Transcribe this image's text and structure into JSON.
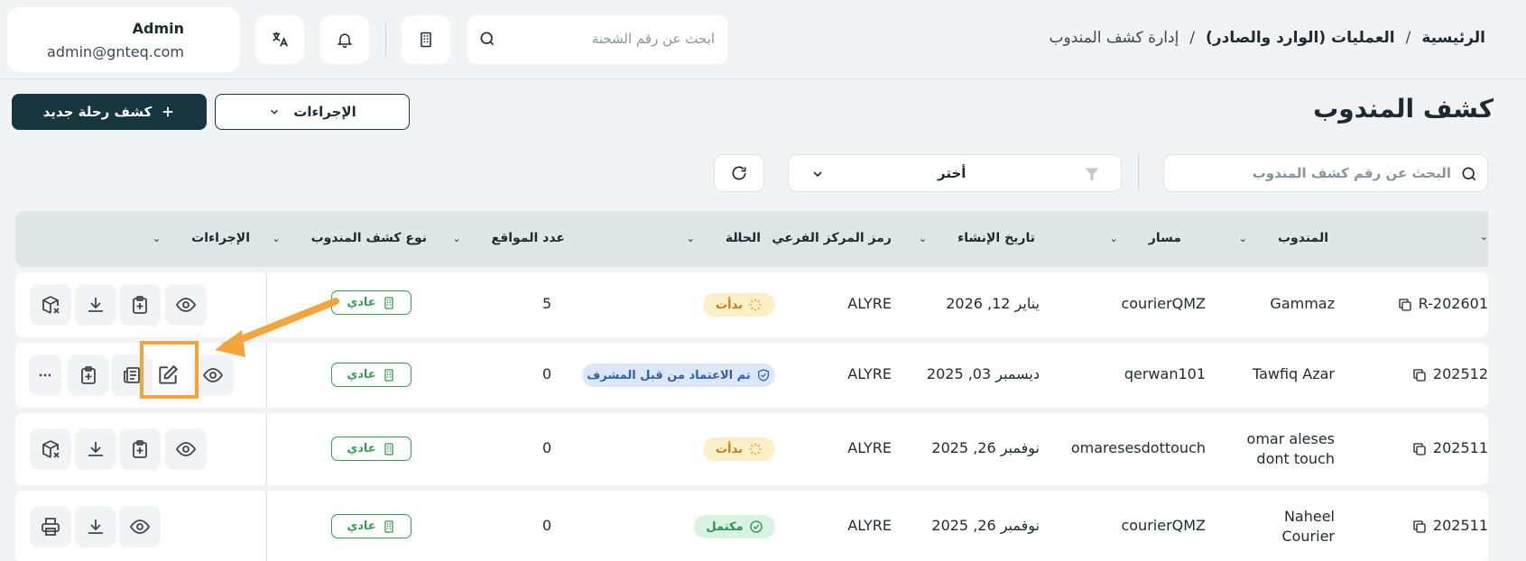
{
  "header": {
    "user_name": "Admin",
    "user_email": "admin@gnteq.com",
    "search_placeholder": "ابحث عن رقم الشحنة",
    "breadcrumb": [
      "الرئيسية",
      "العمليات (الوارد والصادر)",
      "إدارة كشف المندوب"
    ],
    "breadcrumb_sep": "/"
  },
  "page": {
    "title": "كشف المندوب",
    "new_button": "كشف رحلة جديد",
    "actions_button": "الإجراءات"
  },
  "filters": {
    "search_placeholder": "البحث عن رقم كشف المندوب",
    "select_value": "أختر"
  },
  "table": {
    "columns": [
      "",
      "المندوب",
      "مسار",
      "تاريخ الإنشاء",
      "رمز المركز الفرعي",
      "الحالة",
      "عدد المواقع",
      "نوع كشف المندوب",
      "الإجراءات"
    ],
    "rows": [
      {
        "id": "R-202601",
        "courier": "Gammaz",
        "route": "courierQMZ",
        "date": "يناير 12, 2026",
        "branch": "ALYRE",
        "status": "بدأت",
        "sites": "5",
        "type": "عادي"
      },
      {
        "id": "202512",
        "courier": "Tawfiq Azar",
        "route": "qerwan101",
        "date": "ديسمبر 03, 2025",
        "branch": "ALYRE",
        "status": "تم الاعتماد من قبل المشرف",
        "sites": "0",
        "type": "عادي"
      },
      {
        "id": "202511",
        "courier": "omar aleses dont touch",
        "courier_l1": "omar aleses",
        "courier_l2": "dont touch",
        "route": "omaresesdottouch",
        "date": "نوفمبر 26, 2025",
        "branch": "ALYRE",
        "status": "بدأت",
        "sites": "0",
        "type": "عادي"
      },
      {
        "id": "202511",
        "courier": "Naheel Courier",
        "courier_l1": "Naheel",
        "courier_l2": "Courier",
        "route": "courierQMZ",
        "date": "نوفمبر 26, 2025",
        "branch": "ALYRE",
        "status": "مكتمل",
        "sites": "0",
        "type": "عادي"
      }
    ]
  },
  "colors": {
    "primary": "#17363d",
    "highlight": "#f2a53f",
    "started": "#c97a10",
    "approved": "#2f5fb5",
    "done": "#2f8f4e"
  }
}
